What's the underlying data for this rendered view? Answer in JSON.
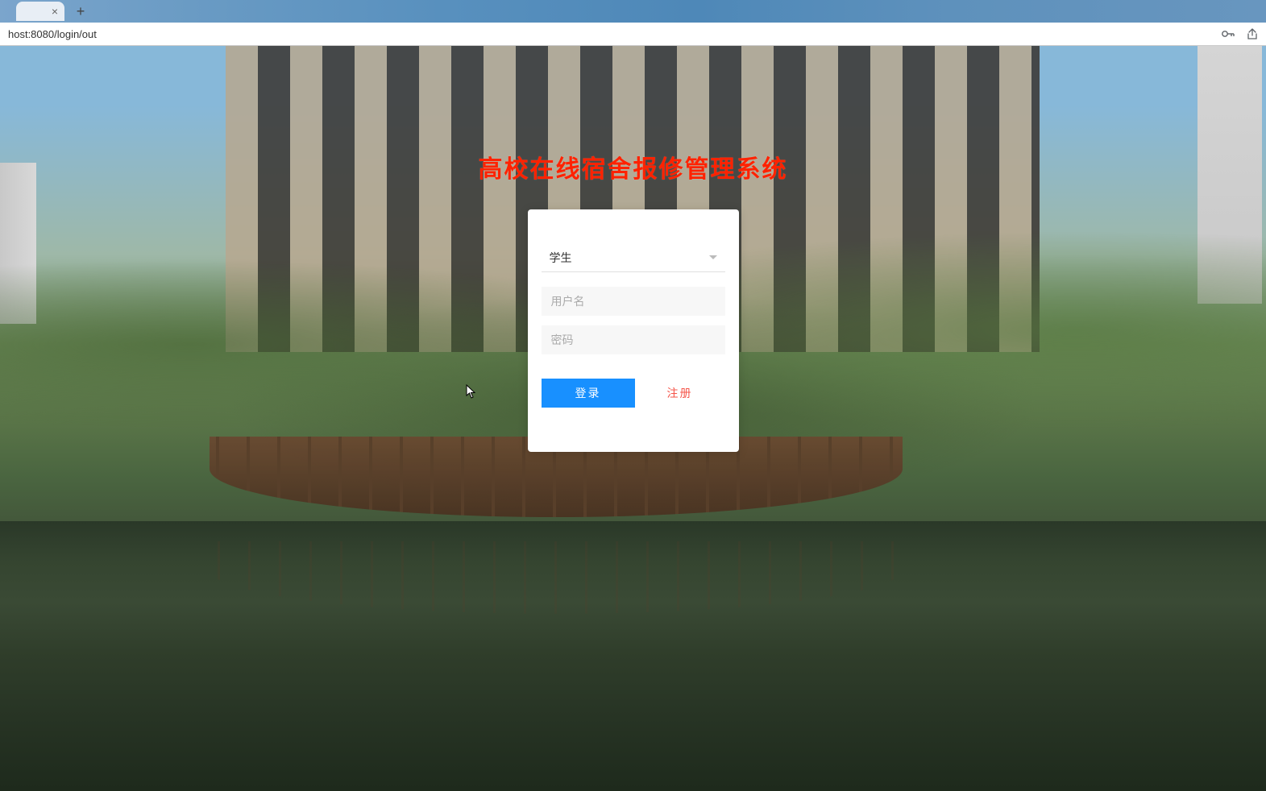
{
  "browser": {
    "url": "host:8080/login/out"
  },
  "page": {
    "title": "高校在线宿舍报修管理系统"
  },
  "form": {
    "role_selected": "学生",
    "username_placeholder": "用户名",
    "password_placeholder": "密码",
    "login_label": "登录",
    "register_label": "注册"
  }
}
